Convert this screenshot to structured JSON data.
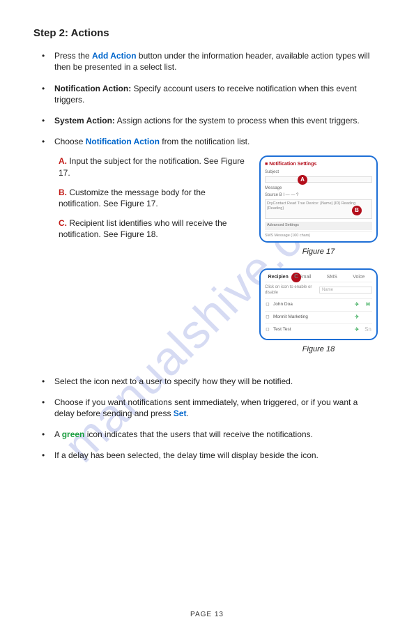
{
  "watermark": "manualshive.com",
  "heading": "Step 2: Actions",
  "bullets": {
    "b1_a": "Press the ",
    "b1_link": "Add Action",
    "b1_b": " button under the information header, available action types will then be presented in a select list.",
    "b2_a": "Notification Action:",
    "b2_b": " Specify account users to receive notification when this event triggers.",
    "b3_a": "System Action:",
    "b3_b": " Assign actions for the system to process when this event triggers.",
    "b4_a": "Choose ",
    "b4_link": "Notification Action",
    "b4_b": " from the notification list.",
    "b5": "Select the icon next to a user to specify how they will be notified.",
    "b6_a": "Choose if you want notifications sent immediately, when triggered, or if you want a delay before sending and press ",
    "b6_link": "Set",
    "b6_b": ".",
    "b7_a": "A ",
    "b7_g": "green",
    "b7_b": " icon indicates that the users that will receive the notifications.",
    "b8": "If a delay has been selected, the delay time will display beside the icon."
  },
  "letters": {
    "A": "Input the subject for the notification. See Figure 17.",
    "B": "Customize the message body for the notification. See Figure 17.",
    "C": "Recipient list identifies who will receive the notification. See Figure 18."
  },
  "fig17": {
    "title": "Notification Settings",
    "subject_label": "Subject",
    "message_label": "Message",
    "toolbar": "Source  B  I  —  —  ?",
    "body": "DryContact Read True Device: {Name}  {ID} Reading {Reading}",
    "advanced": "Advanced Settings",
    "sms": "SMS Message (160 chars)",
    "caption": "Figure 17",
    "badgeA": "A",
    "badgeB": "B"
  },
  "fig18": {
    "tabs": {
      "t1": "Recipien",
      "t2": "Email",
      "t3": "SMS",
      "t4": "Voice"
    },
    "hint": "Click on icon to enable or disable",
    "name_ph": "Name",
    "rows": [
      {
        "name": "John Doa",
        "send": true,
        "chat": true
      },
      {
        "name": "Monnit Marketing",
        "send": true,
        "chat": false
      },
      {
        "name": "Test Test",
        "send": true,
        "chat": false,
        "extra": "Sn"
      }
    ],
    "caption": "Figure 18",
    "badgeC": "C"
  },
  "page": "PAGE  13"
}
